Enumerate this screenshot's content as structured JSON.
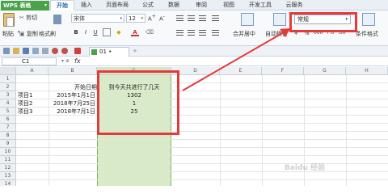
{
  "app": {
    "name": "WPS 表格",
    "dropdown": "▾"
  },
  "menu": {
    "tabs": [
      "开始",
      "插入",
      "页面布局",
      "公式",
      "数据",
      "审阅",
      "视图",
      "开发工具",
      "云服务"
    ],
    "active": 0
  },
  "ribbon": {
    "paste": "粘贴",
    "cut": "剪切",
    "copy": "复制",
    "format_painter": "格式刷",
    "font_name": "宋体",
    "font_size": "12",
    "bold": "B",
    "italic": "I",
    "underline": "U",
    "font_color": "A",
    "merge_center": "合并居中",
    "wrap_text": "自动换行",
    "number_format": "常规",
    "percent": "%",
    "thousands": "000",
    "decimal_more": "+.0",
    "decimal_less": ".00",
    "cond_format": "条件格式"
  },
  "doc_tab": {
    "name": "01"
  },
  "formula_bar": {
    "cell_ref": "C1",
    "fx": "fx",
    "content": ""
  },
  "grid": {
    "columns": [
      "A",
      "B",
      "C",
      "D",
      "E",
      "F",
      "G",
      "H"
    ],
    "selected_column": "C",
    "rows": [
      "1",
      "2",
      "3",
      "4",
      "5",
      "6",
      "7",
      "8",
      "9",
      "10",
      "11",
      "12",
      "13",
      "14"
    ],
    "cells": {
      "B2": "开始日期",
      "C2": "到今天共进行了几天",
      "A3": "项目1",
      "B3": "2015年1月1日",
      "C3": "1302",
      "A4": "项目2",
      "B4": "2018年7月25日",
      "C4": "1",
      "A5": "项目3",
      "B5": "2018年7月1日",
      "C5": "25"
    }
  },
  "annotation": {
    "color": "#e53a3a"
  },
  "watermark": "Baidu 经验"
}
